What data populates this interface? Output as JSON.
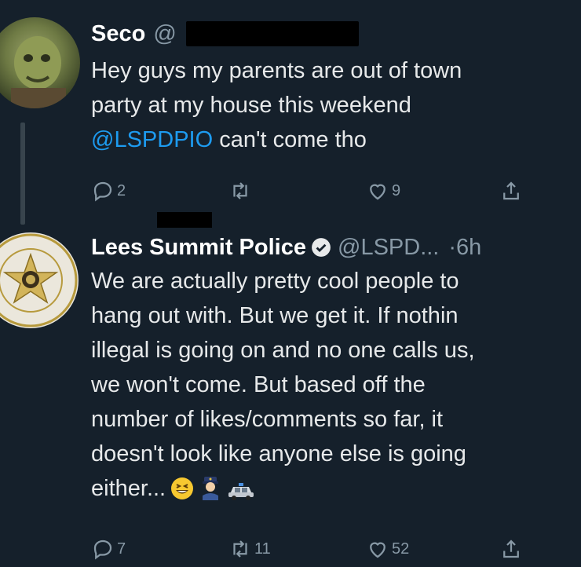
{
  "tweet1": {
    "display_name": "Seco",
    "handle": "@",
    "body_line1": "Hey guys my parents are out of town",
    "body_line2": "party at my house this weekend",
    "mention": "@LSPDPIO",
    "body_line3_rest": " can't come tho",
    "reply_count": "2",
    "retweet_count": "",
    "like_count": "9"
  },
  "tweet2": {
    "display_name": "Lees Summit Police",
    "handle": "@LSPD...",
    "time": "·6h",
    "body": [
      "We are actually pretty cool people to",
      "hang out with.  But we get it.  If nothin",
      "illegal is going on and no one calls us,",
      "we won't come.  But based off the",
      "number of likes/comments so far, it",
      "doesn't look like anyone else is going",
      "either..."
    ],
    "reply_count": "7",
    "retweet_count": "11",
    "like_count": "52"
  },
  "colors": {
    "background": "#15202b",
    "text": "#e7e9ea",
    "secondary": "#8899a6",
    "link": "#1d9bf0"
  },
  "icons": [
    "reply-icon",
    "retweet-icon",
    "like-icon",
    "share-icon",
    "verified-badge-icon",
    "grinning-squinting-emoji",
    "police-officer-emoji",
    "police-car-emoji"
  ]
}
